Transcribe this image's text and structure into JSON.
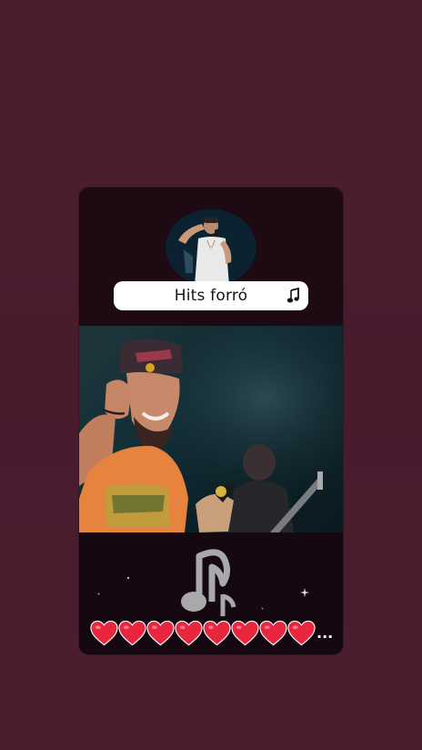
{
  "card": {
    "title": "Hits forró",
    "title_icon": "music-note-icon",
    "avatar": "artist-avatar",
    "video": "concert-video-frame",
    "big_icon": "music-note-icon",
    "hearts_count": 8,
    "hearts_suffix": "...",
    "heart_color": "#e8263d"
  },
  "colors": {
    "background": "#4a1d2e",
    "card": "#1e0a12",
    "pill": "#ffffff"
  }
}
